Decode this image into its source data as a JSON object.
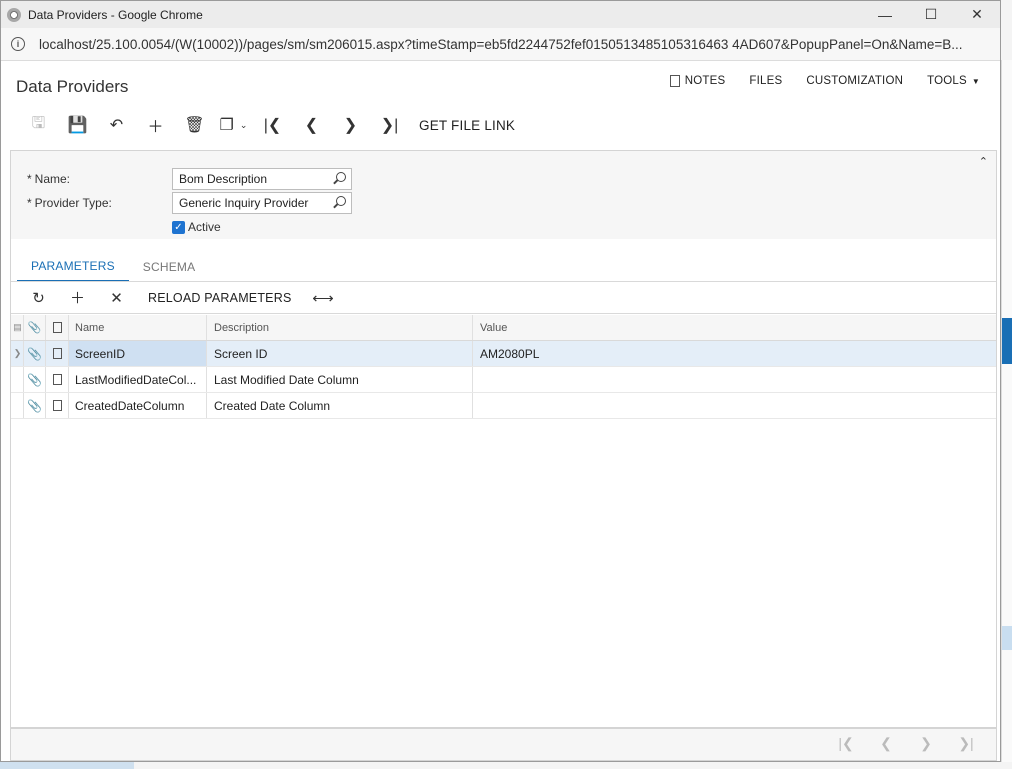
{
  "window": {
    "title": "Data Providers - Google Chrome",
    "url": "localhost/25.100.0054/(W(10002))/pages/sm/sm206015.aspx?timeStamp=eb5fd2244752fef0150513485105316463 4AD607&PopupPanel=On&Name=B..."
  },
  "header": {
    "title": "Data Providers",
    "links": {
      "notes": "NOTES",
      "files": "FILES",
      "customization": "CUSTOMIZATION",
      "tools": "TOOLS"
    }
  },
  "toolbar": {
    "get_file_link": "GET FILE LINK"
  },
  "form": {
    "name_label": "Name:",
    "name_value": "Bom Description",
    "provider_type_label": "Provider Type:",
    "provider_type_value": "Generic Inquiry Provider",
    "active_label": "Active",
    "active_checked": true
  },
  "tabs": [
    {
      "label": "PARAMETERS",
      "active": true
    },
    {
      "label": "SCHEMA",
      "active": false
    }
  ],
  "grid_toolbar": {
    "reload_label": "RELOAD PARAMETERS"
  },
  "grid": {
    "columns": {
      "name": "Name",
      "description": "Description",
      "value": "Value"
    },
    "rows": [
      {
        "name": "ScreenID",
        "description": "Screen ID",
        "value": "AM2080PL"
      },
      {
        "name": "LastModifiedDateCol...",
        "description": "Last Modified Date Column",
        "value": ""
      },
      {
        "name": "CreatedDateColumn",
        "description": "Created Date Column",
        "value": ""
      }
    ]
  },
  "colors": {
    "accent": "#1a6fb5",
    "selected_row": "#e4eef8",
    "checkbox": "#1e73d0"
  }
}
